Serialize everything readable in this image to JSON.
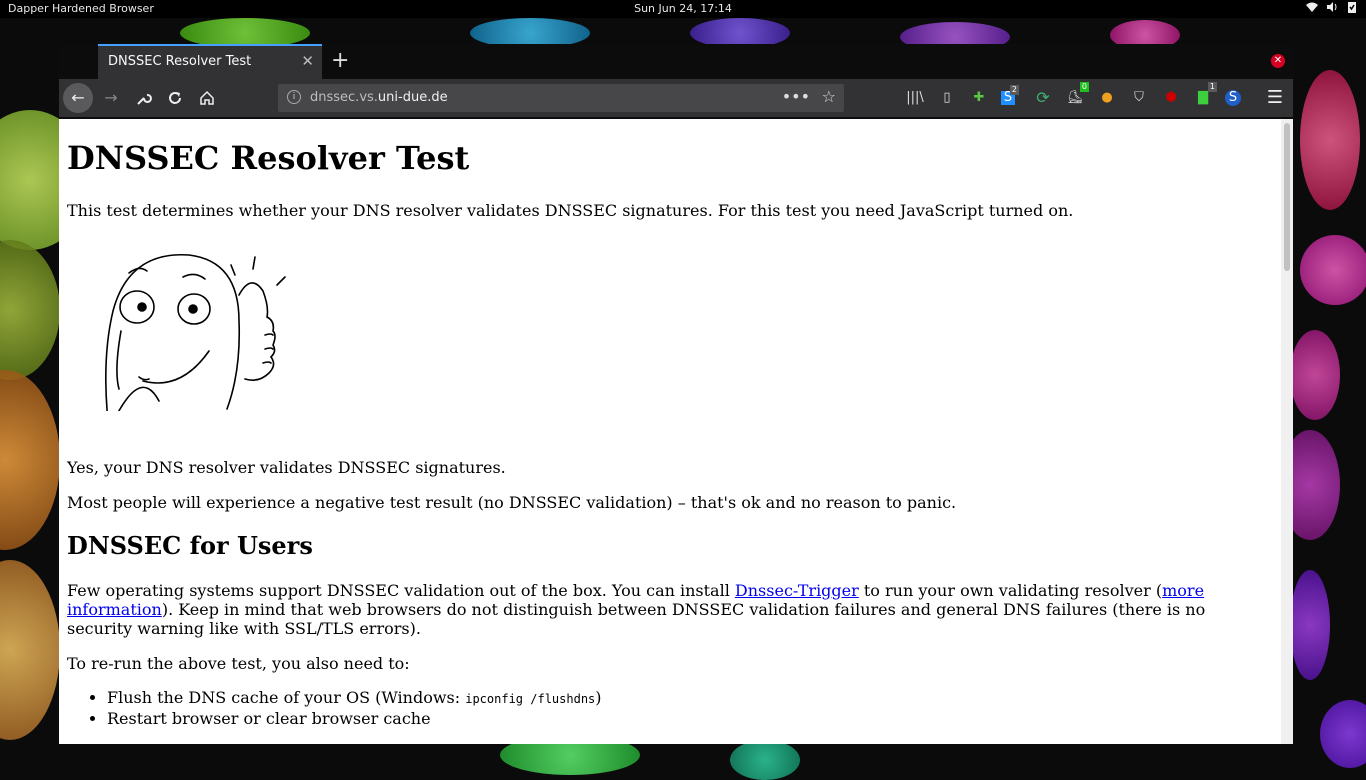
{
  "topbar": {
    "app_name": "Dapper Hardened Browser",
    "clock": "Sun Jun 24, 17:14",
    "tray_icons": [
      "wifi-icon",
      "volume-icon",
      "clipboard-check-icon"
    ]
  },
  "browser": {
    "tab_title": "DNSSEC Resolver Test",
    "url_prefix": "dnssec.vs.",
    "url_host": "uni-due.de",
    "extensions": [
      {
        "name": "library-icon",
        "badge": ""
      },
      {
        "name": "sidebar-icon",
        "badge": ""
      },
      {
        "name": "puzzle-extension-icon",
        "badge": ""
      },
      {
        "name": "s-extension-icon",
        "badge": "2"
      },
      {
        "name": "sync-extension-icon",
        "badge": ""
      },
      {
        "name": "shoe-extension-icon",
        "badge": "0"
      },
      {
        "name": "burger-extension-icon",
        "badge": ""
      },
      {
        "name": "privacy-shield-icon",
        "badge": ""
      },
      {
        "name": "ublock-icon",
        "badge": ""
      },
      {
        "name": "green-block-extension-icon",
        "badge": "1"
      },
      {
        "name": "s-circle-extension-icon",
        "badge": ""
      }
    ]
  },
  "page": {
    "title": "DNSSEC Resolver Test",
    "intro": "This test determines whether your DNS resolver validates DNSSEC signatures. For this test you need JavaScript turned on.",
    "result": "Yes, your DNS resolver validates DNSSEC signatures.",
    "note": "Most people will experience a negative test result (no DNSSEC validation) – that's ok and no reason to panic.",
    "users_heading": "DNSSEC for Users",
    "users_text_1": "Few operating systems support DNSSEC validation out of the box. You can install ",
    "link_trigger": "Dnssec-Trigger",
    "users_text_2": " to run your own validating resolver (",
    "link_more": "more information",
    "users_text_3": "). Keep in mind that web browsers do not distinguish between DNSSEC validation failures and general DNS failures (there is no security warning like with SSL/TLS errors).",
    "rerun_text": "To re-run the above test, you also need to:",
    "bullet1_text": "Flush the DNS cache of your OS (Windows: ",
    "bullet1_code": "ipconfig /flushdns",
    "bullet1_end": ")",
    "bullet2_text": "Restart browser or clear browser cache"
  }
}
